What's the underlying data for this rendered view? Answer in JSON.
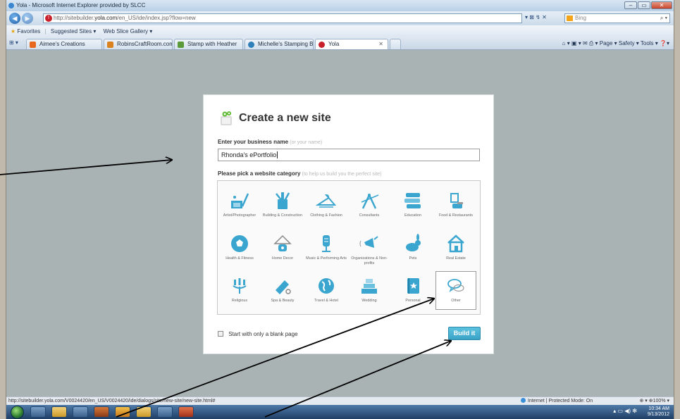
{
  "window": {
    "title": "Yola - Microsoft Internet Explorer provided by SLCC",
    "controls": [
      "–",
      "▭",
      "✕"
    ]
  },
  "address": {
    "url_prefix": "http://sitebuilder.",
    "url_domain": "yola.com",
    "url_rest": "/en_US/ide/index.jsp?flow=new",
    "tools": "▾ ⊠ ↯ ✕",
    "search_placeholder": "Bing"
  },
  "favorites": {
    "label": "Favorites",
    "items": [
      "Suggested Sites ▾",
      "Web Slice Gallery ▾"
    ]
  },
  "tabs": [
    {
      "label": "Aimee's Creations",
      "color": "#e8671f"
    },
    {
      "label": "RobinsCraftRoom.com",
      "color": "#d9821f"
    },
    {
      "label": "Stamp with Heather",
      "color": "#5a9a3a"
    },
    {
      "label": "Michelle's Stamping Blog",
      "color": "#2f7fb8"
    },
    {
      "label": "Yola",
      "color": "#c8202a"
    }
  ],
  "commandbar": "⌂ ▾  ▣ ▾  ✉  ⎙ ▾  Page ▾  Safety ▾  Tools ▾  ❓▾",
  "dialog": {
    "title": "Create a new site",
    "name_label": "Enter your business name",
    "name_hint": "(or your name)",
    "name_value": "Rhonda's ePortfolio",
    "category_label": "Please pick a website category",
    "category_hint": "(to help us build you the perfect site)",
    "categories": [
      {
        "label": "Artist/Photographer",
        "icon": "palette-icon"
      },
      {
        "label": "Building & Construction",
        "icon": "tools-icon"
      },
      {
        "label": "Clothing & Fashion",
        "icon": "hanger-icon"
      },
      {
        "label": "Consultants",
        "icon": "compass-icon"
      },
      {
        "label": "Education",
        "icon": "books-icon"
      },
      {
        "label": "Food & Restaurants",
        "icon": "food-icon"
      },
      {
        "label": "Health & Fitness",
        "icon": "soccer-ball-icon"
      },
      {
        "label": "Home Decor",
        "icon": "lamp-icon"
      },
      {
        "label": "Music & Performing Arts",
        "icon": "microphone-icon"
      },
      {
        "label": "Organizations & Non-profits",
        "icon": "megaphone-icon"
      },
      {
        "label": "Pets",
        "icon": "rabbit-icon"
      },
      {
        "label": "Real Estate",
        "icon": "house-icon"
      },
      {
        "label": "Religious",
        "icon": "candelabra-icon"
      },
      {
        "label": "Spa & Beauty",
        "icon": "comb-icon"
      },
      {
        "label": "Travel & Hotel",
        "icon": "globe-icon"
      },
      {
        "label": "Wedding",
        "icon": "cake-icon"
      },
      {
        "label": "Personal",
        "icon": "notebook-icon"
      },
      {
        "label": "Other",
        "icon": "speech-bubbles-icon",
        "selected": true
      }
    ],
    "blank_page_label": "Start with only a blank page",
    "build_label": "Build it",
    "accent_color": "#44aed4"
  },
  "status": {
    "url": "http://sitebuilder.yola.com/V0024420/en_US/V0024420/ide/dialogs/site/new-site/new-site.html#",
    "zone": "Internet | Protected Mode: On",
    "zoom": "⊕ ▾  ⊕100% ▾"
  },
  "taskbar": {
    "time": "10:34 AM",
    "date": "9/13/2012"
  }
}
